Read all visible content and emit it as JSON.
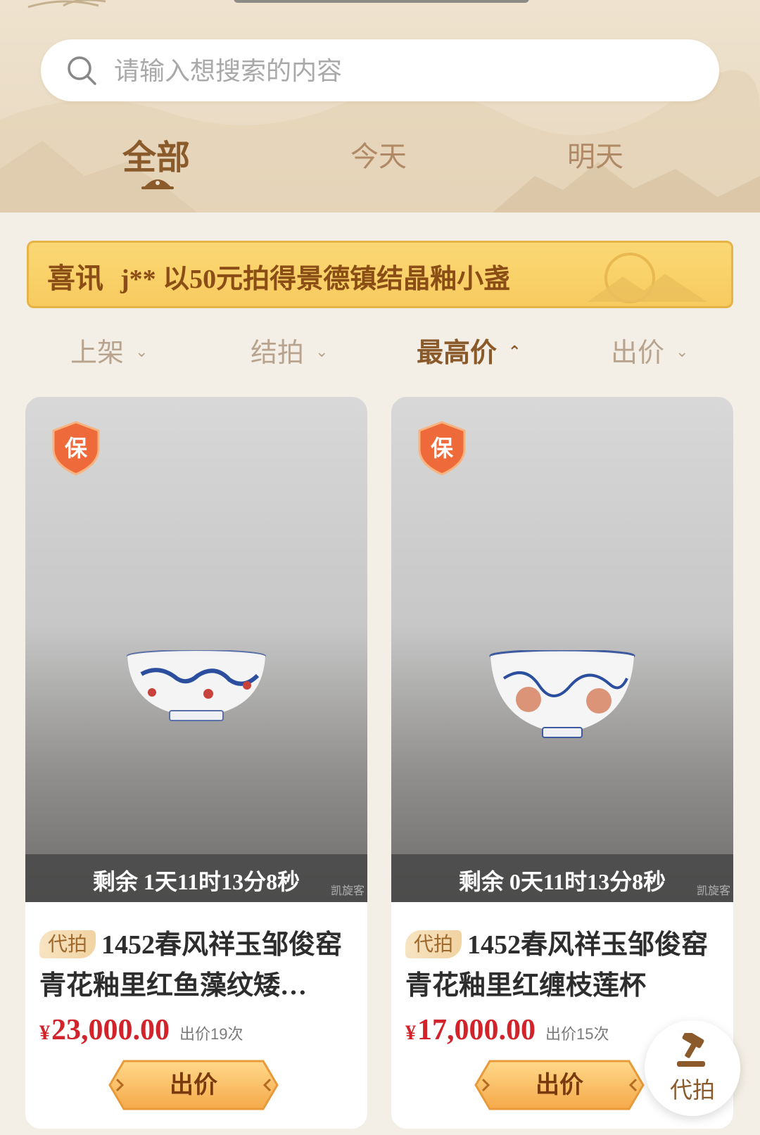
{
  "search": {
    "placeholder": "请输入想搜索的内容"
  },
  "tabs": [
    {
      "label": "全部",
      "active": true
    },
    {
      "label": "今天",
      "active": false
    },
    {
      "label": "明天",
      "active": false
    }
  ],
  "notice": {
    "title": "喜讯",
    "text": "j** 以50元拍得景德镇结晶釉小盏"
  },
  "sort": [
    {
      "label": "上架",
      "chevron": "⌄",
      "active": false
    },
    {
      "label": "结拍",
      "chevron": "⌄",
      "active": false
    },
    {
      "label": "最高价",
      "chevron": "⌃",
      "active": true
    },
    {
      "label": "出价",
      "chevron": "⌄",
      "active": false
    }
  ],
  "items": [
    {
      "badge": "保",
      "timer": "剩余  1天11时13分8秒",
      "tag": "代拍",
      "title": "1452春风祥玉邹俊窑青花釉里红鱼藻纹矮…",
      "currency": "¥",
      "price": "23,000.00",
      "bids": "出价19次",
      "button": "出价",
      "watermark": "凯旋客"
    },
    {
      "badge": "保",
      "timer": "剩余  0天11时13分8秒",
      "tag": "代拍",
      "title": "1452春风祥玉邹俊窑青花釉里红缠枝莲杯",
      "currency": "¥",
      "price": "17,000.00",
      "bids": "出价15次",
      "button": "出价",
      "watermark": "凯旋客"
    }
  ],
  "float_button": {
    "label": "代拍",
    "icon": "gavel-icon"
  },
  "colors": {
    "accent": "#8b5a2b",
    "price": "#d2232a",
    "notice_bg": "#f7cb5f"
  }
}
